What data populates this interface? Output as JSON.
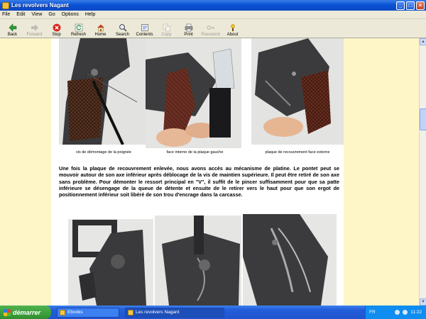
{
  "window": {
    "title": "Les revolvers Nagant"
  },
  "menu": [
    "File",
    "Edit",
    "View",
    "Go",
    "Options",
    "Help"
  ],
  "toolbar": [
    {
      "label": "Back",
      "icon": "back-arrow-icon",
      "enabled": true
    },
    {
      "label": "Forward",
      "icon": "forward-arrow-icon",
      "enabled": false
    },
    {
      "label": "Stop",
      "icon": "stop-icon",
      "enabled": true
    },
    {
      "label": "Refresh",
      "icon": "refresh-icon",
      "enabled": true
    },
    {
      "label": "Home",
      "icon": "home-icon",
      "enabled": true
    },
    {
      "label": "Search",
      "icon": "search-icon",
      "enabled": true
    },
    {
      "label": "Contents",
      "icon": "contents-icon",
      "enabled": true
    },
    {
      "label": "Copy",
      "icon": "copy-icon",
      "enabled": false
    },
    {
      "label": "Print",
      "icon": "print-icon",
      "enabled": true
    },
    {
      "label": "Password",
      "icon": "key-icon",
      "enabled": false
    },
    {
      "label": "About",
      "icon": "about-icon",
      "enabled": true
    }
  ],
  "page": {
    "captions": [
      "vis de démontage de la poignée",
      "face interne de la plaque gauche",
      "plaque de recouvrement face externe"
    ],
    "paragraph": "Une fois la plaque de recouvrement enlevée, nous avons accès au mécanisme de platine. Le pontet peut se mouvoir autour de son axe inférieur après déblocage de la vis de maintien supérieure. Il peut être retiré de son axe sans problème. Pour démonter le ressort principal en \"V\", il suffit de le pincer suffisamment pour que sa patte inférieure se désengage de la queue de détente et ensuite de le retirer vers le haut pour que son ergot de positionnement inférieur soit libéré de son trou d'encrage dans la carcasse."
  },
  "taskbar": {
    "start_label": "démarrer",
    "tasks": [
      {
        "label": "Ebooks",
        "active": false
      },
      {
        "label": "Les revolvers Nagant",
        "active": true
      }
    ],
    "language": "FR",
    "clock": "11:22"
  },
  "colors": {
    "title_bar": "#0a52d6",
    "page_margin": "#fff6c8",
    "taskbar": "#245edb",
    "start_button": "#3c9e3c"
  }
}
